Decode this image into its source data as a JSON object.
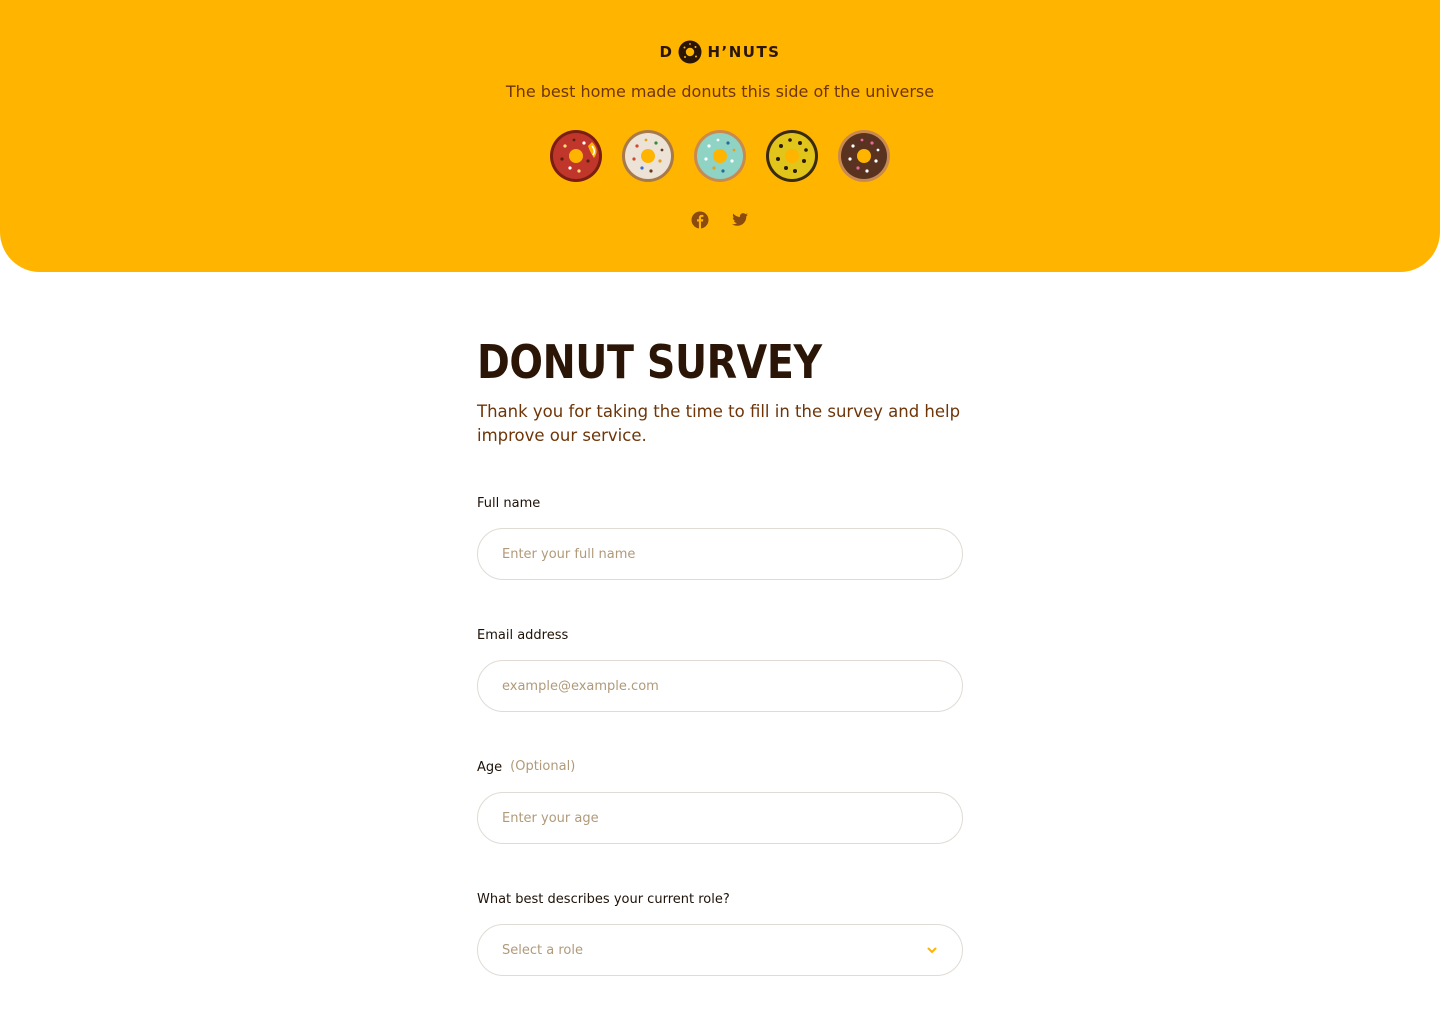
{
  "header": {
    "logo_left": "D",
    "logo_right": "H’NUTS",
    "tagline": "The best home made donuts this side of the universe",
    "donuts": [
      {
        "icon": "donut-red-sprinkles-icon",
        "color": "#c0362a"
      },
      {
        "icon": "donut-white-sprinkles-icon",
        "color": "#ece2d6"
      },
      {
        "icon": "donut-mint-sprinkles-icon",
        "color": "#8fd3c4"
      },
      {
        "icon": "donut-yellow-chocolate-icon",
        "color": "#e2c51a"
      },
      {
        "icon": "donut-chocolate-sprinkles-icon",
        "color": "#5a3320"
      }
    ],
    "socials": [
      "facebook-icon",
      "twitter-icon"
    ]
  },
  "colors": {
    "brand_yellow": "#ffb400",
    "dark_brown": "#2a1507",
    "text_brown": "#6e3508",
    "placeholder": "#b09a7a",
    "border": "#e0dbd4"
  },
  "survey": {
    "title": "DONUT SURVEY",
    "intro": "Thank you for taking the time to fill in the survey and help improve our service.",
    "fields": {
      "full_name": {
        "label": "Full name",
        "placeholder": "Enter your full name"
      },
      "email": {
        "label": "Email address",
        "placeholder": "example@example.com"
      },
      "age": {
        "label": "Age",
        "optional": "(Optional)",
        "placeholder": "Enter your age"
      },
      "role": {
        "label": "What best describes your current role?",
        "placeholder": "Select a role",
        "icon": "chevron-down-icon"
      }
    }
  }
}
